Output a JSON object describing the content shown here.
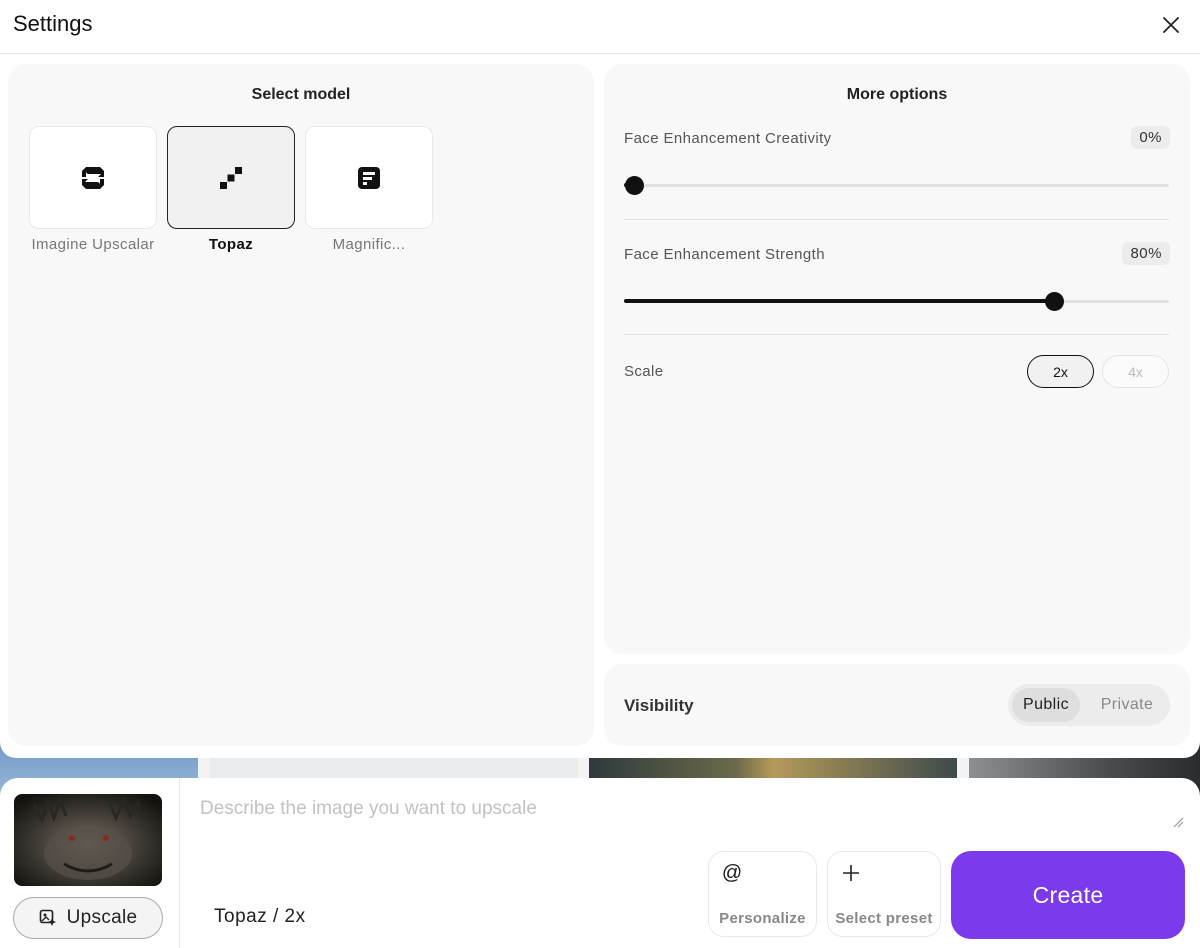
{
  "modal": {
    "title": "Settings"
  },
  "select_model": {
    "title": "Select model",
    "models": [
      {
        "label": "Imagine Upscalar",
        "icon": "imagine-logo-icon",
        "selected": false
      },
      {
        "label": "Topaz",
        "icon": "topaz-logo-icon",
        "selected": true
      },
      {
        "label": "Magnific...",
        "icon": "magnific-logo-icon",
        "selected": false
      }
    ]
  },
  "more_options": {
    "title": "More options",
    "face_creativity": {
      "label": "Face Enhancement Creativity",
      "value_text": "0%",
      "value": 0
    },
    "face_strength": {
      "label": "Face Enhancement Strength",
      "value_text": "80%",
      "value": 80
    },
    "scale": {
      "label": "Scale",
      "options": [
        "2x",
        "4x"
      ],
      "selected": "2x"
    }
  },
  "visibility": {
    "label": "Visibility",
    "options": [
      "Public",
      "Private"
    ],
    "selected": "Public"
  },
  "bottom_bar": {
    "upscale_label": "Upscale",
    "prompt_placeholder": "Describe the image you want to upscale",
    "model_summary": "Topaz / 2x",
    "personalize_label": "Personalize",
    "select_preset_label": "Select preset",
    "create_label": "Create"
  },
  "colors": {
    "accent": "#7c3aed"
  }
}
